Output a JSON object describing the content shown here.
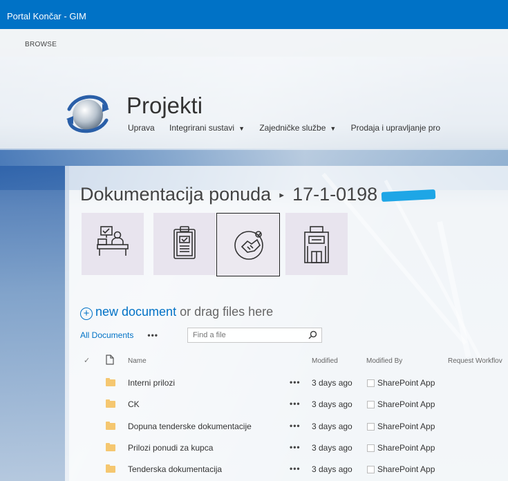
{
  "suite_bar": {
    "title": "Portal Končar - GIM"
  },
  "ribbon": {
    "browse_label": "BROWSE"
  },
  "site": {
    "title": "Projekti",
    "nav": [
      {
        "label": "Uprava",
        "has_dropdown": false
      },
      {
        "label": "Integrirani sustavi",
        "has_dropdown": true
      },
      {
        "label": "Zajedničke službe",
        "has_dropdown": true
      },
      {
        "label": "Prodaja i upravljanje pro",
        "has_dropdown": false
      }
    ]
  },
  "breadcrumb": {
    "parent": "Dokumentacija ponuda",
    "current": "17-1-0198"
  },
  "tiles": [
    {
      "icon": "office-desk-icon",
      "selected": false
    },
    {
      "icon": "clipboard-checklist-icon",
      "selected": false
    },
    {
      "icon": "handshake-agreement-icon",
      "selected": true
    },
    {
      "icon": "building-icon",
      "selected": false
    }
  ],
  "upload": {
    "new_document_label": "new document",
    "drag_text": "or drag files here"
  },
  "view": {
    "current_view": "All Documents",
    "more_label": "•••",
    "search_placeholder": "Find a file"
  },
  "table": {
    "columns": {
      "name": "Name",
      "modified": "Modified",
      "modified_by": "Modified By",
      "workflow": "Request Workflov"
    },
    "rows": [
      {
        "name": "Interni prilozi",
        "modified": "3 days ago",
        "modified_by": "SharePoint App"
      },
      {
        "name": "CK",
        "modified": "3 days ago",
        "modified_by": "SharePoint App"
      },
      {
        "name": "Dopuna tenderske dokumentacije",
        "modified": "3 days ago",
        "modified_by": "SharePoint App"
      },
      {
        "name": "Prilozi ponudi za kupca",
        "modified": "3 days ago",
        "modified_by": "SharePoint App"
      },
      {
        "name": "Tenderska dokumentacija",
        "modified": "3 days ago",
        "modified_by": "SharePoint App"
      }
    ],
    "row_menu_label": "•••"
  },
  "colors": {
    "suite_bar": "#0072c6",
    "link": "#0072c6",
    "folder": "#f5c770",
    "redaction": "#1ea6e6"
  }
}
